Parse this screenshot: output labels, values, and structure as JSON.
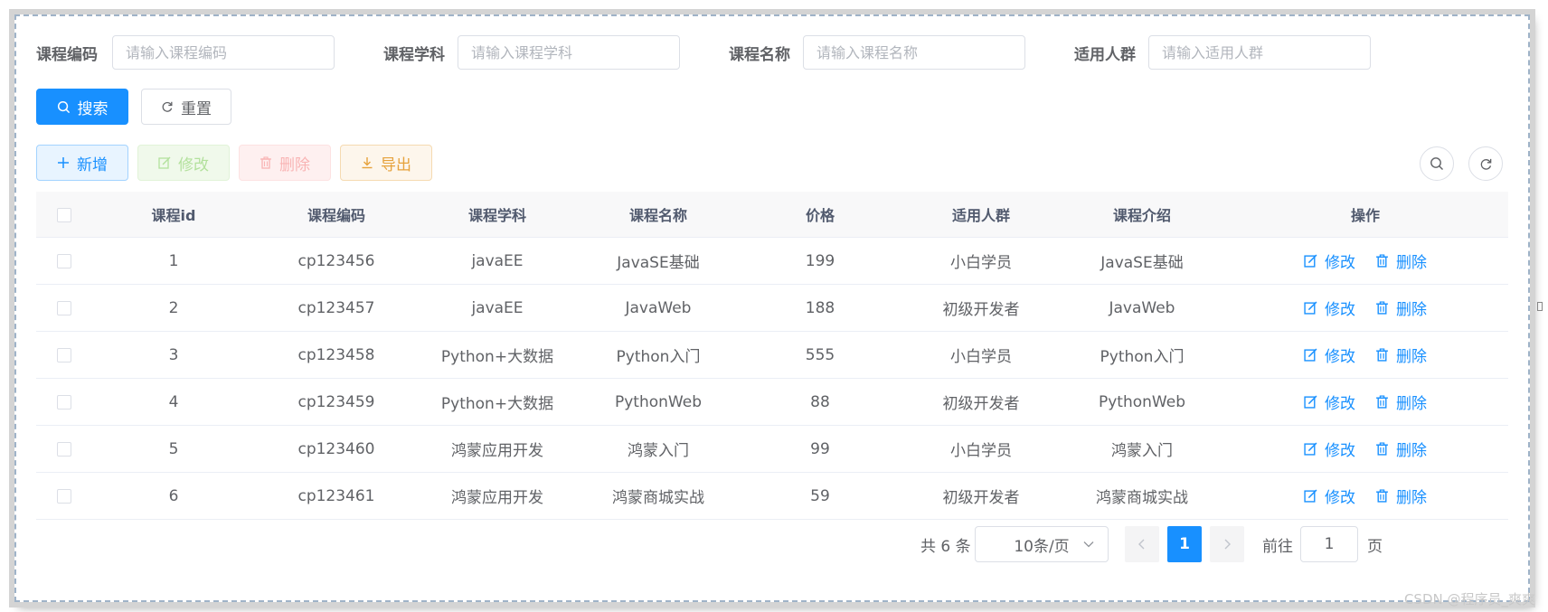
{
  "search": {
    "fields": [
      {
        "label": "课程编码",
        "placeholder": "请输入课程编码"
      },
      {
        "label": "课程学科",
        "placeholder": "请输入课程学科"
      },
      {
        "label": "课程名称",
        "placeholder": "请输入课程名称"
      },
      {
        "label": "适用人群",
        "placeholder": "请输入适用人群"
      }
    ],
    "search_label": "搜索",
    "reset_label": "重置"
  },
  "toolbar": {
    "add_label": "新增",
    "edit_label": "修改",
    "delete_label": "删除",
    "export_label": "导出"
  },
  "table": {
    "columns": [
      "课程id",
      "课程编码",
      "课程学科",
      "课程名称",
      "价格",
      "适用人群",
      "课程介绍",
      "操作"
    ],
    "rows": [
      {
        "id": "1",
        "code": "cp123456",
        "subject": "javaEE",
        "name": "JavaSE基础",
        "price": "199",
        "audience": "小白学员",
        "intro": "JavaSE基础"
      },
      {
        "id": "2",
        "code": "cp123457",
        "subject": "javaEE",
        "name": "JavaWeb",
        "price": "188",
        "audience": "初级开发者",
        "intro": "JavaWeb"
      },
      {
        "id": "3",
        "code": "cp123458",
        "subject": "Python+大数据",
        "name": "Python入门",
        "price": "555",
        "audience": "小白学员",
        "intro": "Python入门"
      },
      {
        "id": "4",
        "code": "cp123459",
        "subject": "Python+大数据",
        "name": "PythonWeb",
        "price": "88",
        "audience": "初级开发者",
        "intro": "PythonWeb"
      },
      {
        "id": "5",
        "code": "cp123460",
        "subject": "鸿蒙应用开发",
        "name": "鸿蒙入门",
        "price": "99",
        "audience": "小白学员",
        "intro": "鸿蒙入门"
      },
      {
        "id": "6",
        "code": "cp123461",
        "subject": "鸿蒙应用开发",
        "name": "鸿蒙商城实战",
        "price": "59",
        "audience": "初级开发者",
        "intro": "鸿蒙商城实战"
      }
    ],
    "row_edit_label": "修改",
    "row_delete_label": "删除"
  },
  "pagination": {
    "total_text": "共 6 条",
    "page_size": "10条/页",
    "current_page": "1",
    "goto_prefix": "前往",
    "goto_value": "1",
    "goto_suffix": "页"
  },
  "watermark": "CSDN @程序员_爽爽",
  "colors": {
    "primary": "#1890ff",
    "success_light": "#f0f9eb",
    "danger_light": "#fef0f0",
    "warning": "#e6a23c"
  }
}
